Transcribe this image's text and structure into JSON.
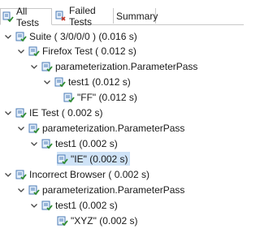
{
  "tabs": [
    {
      "label": "All Tests",
      "icon": "all-tests-icon",
      "active": true
    },
    {
      "label": "Failed Tests",
      "icon": "failed-tests-icon",
      "active": false
    },
    {
      "label": "Summary",
      "icon": "",
      "active": false
    }
  ],
  "tree": [
    {
      "text": "Suite ( 3/0/0/0 ) (0.016 s)",
      "type": "suite"
    },
    {
      "text": "Firefox Test ( 0.012 s)",
      "type": "test"
    },
    {
      "text": "parameterization.ParameterPass",
      "type": "class"
    },
    {
      "text": "test1  (0.012 s)",
      "type": "method"
    },
    {
      "text": "\"FF\"  (0.012 s)",
      "type": "instance"
    },
    {
      "text": "IE Test ( 0.002 s)",
      "type": "test"
    },
    {
      "text": "parameterization.ParameterPass",
      "type": "class"
    },
    {
      "text": "test1  (0.002 s)",
      "type": "method"
    },
    {
      "text": "\"IE\"  (0.002 s)",
      "type": "instance"
    },
    {
      "text": "Incorrect Browser ( 0.002 s)",
      "type": "test"
    },
    {
      "text": "parameterization.ParameterPass",
      "type": "class"
    },
    {
      "text": "test1  (0.002 s)",
      "type": "method"
    },
    {
      "text": "\"XYZ\"  (0.002 s)",
      "type": "instance"
    }
  ],
  "colors": {
    "pass": "#2e8b2e",
    "selection": "#cfe3f7"
  }
}
